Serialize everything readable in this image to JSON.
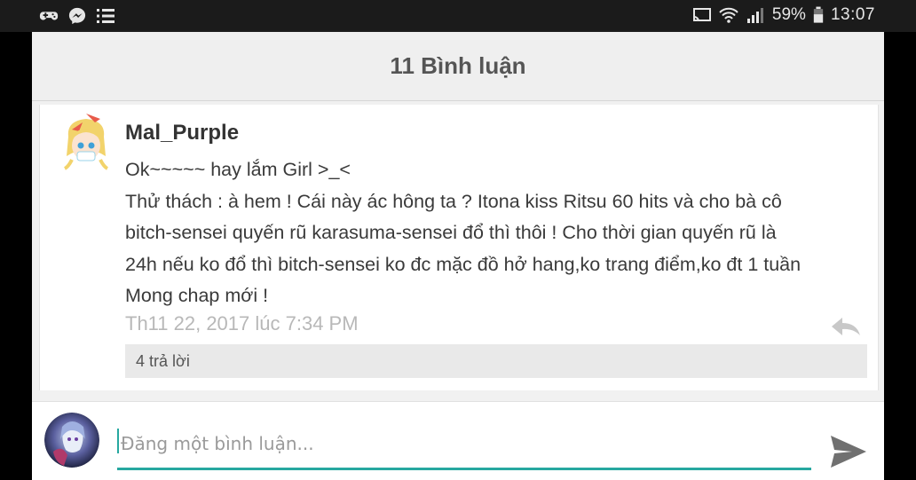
{
  "status_bar": {
    "left_icons": [
      "gamepad-icon",
      "messenger-icon",
      "list-icon"
    ],
    "right_icons": [
      "cast-icon",
      "wifi-icon",
      "signal-icon",
      "battery-icon"
    ],
    "battery": "59%",
    "time": "13:07"
  },
  "header": {
    "title": "11 Bình luận"
  },
  "comment": {
    "username": "Mal_Purple",
    "lines": [
      "Ok~~~~~ hay lắm Girl >_<",
      "Thử thách : à hem ! Cái này ác hông ta ? Itona kiss Ritsu 60 hits và cho bà cô",
      "bitch-sensei quyến rũ karasuma-sensei đổ thì thôi ! Cho thời gian quyến rũ là",
      "24h nếu ko đổ thì bitch-sensei ko đc mặc đồ hở hang,ko trang điểm,ko đt 1 tuần",
      "Mong chap mới !"
    ],
    "timestamp": "Th11 22, 2017 lúc 7:34 PM",
    "replies_label": "4 trả lời",
    "reply_icon": "reply-icon"
  },
  "composer": {
    "placeholder": "Đăng một bình luận...",
    "value": "",
    "send_icon": "send-icon",
    "accent_color": "#27a8a0"
  }
}
